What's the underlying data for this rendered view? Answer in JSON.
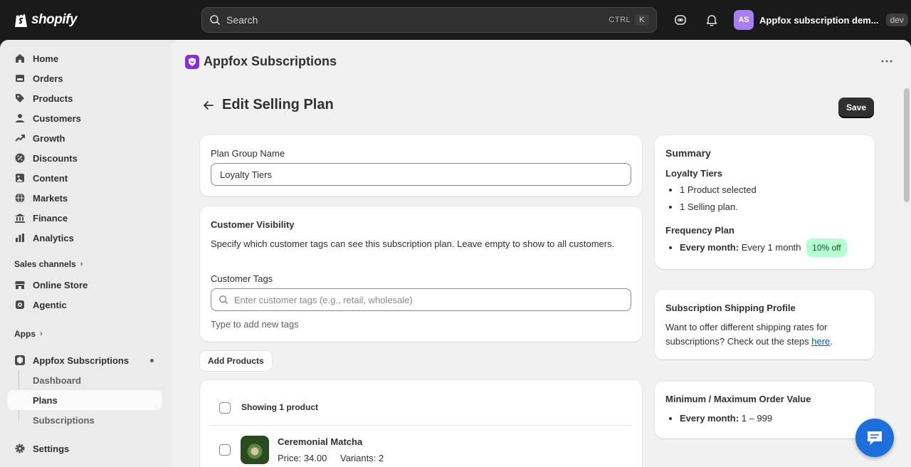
{
  "topbar": {
    "logo_text": "shopify",
    "search_placeholder": "Search",
    "shortcut_ctrl": "CTRL",
    "shortcut_key": "K",
    "store_initials": "AS",
    "store_name": "Appfox subscription dem...",
    "store_badge": "dev"
  },
  "sidebar": {
    "items": [
      {
        "label": "Home",
        "icon": "home-icon"
      },
      {
        "label": "Orders",
        "icon": "orders-icon"
      },
      {
        "label": "Products",
        "icon": "tag-icon"
      },
      {
        "label": "Customers",
        "icon": "person-icon"
      },
      {
        "label": "Growth",
        "icon": "growth-icon"
      },
      {
        "label": "Discounts",
        "icon": "discount-icon"
      },
      {
        "label": "Content",
        "icon": "content-icon"
      },
      {
        "label": "Markets",
        "icon": "globe-icon"
      },
      {
        "label": "Finance",
        "icon": "bank-icon"
      },
      {
        "label": "Analytics",
        "icon": "chart-icon"
      }
    ],
    "sales_channels_title": "Sales channels",
    "sales_channels": [
      {
        "label": "Online Store",
        "icon": "store-icon"
      },
      {
        "label": "Agentic",
        "icon": "agentic-icon"
      }
    ],
    "apps_title": "Apps",
    "app_name": "Appfox Subscriptions",
    "app_sub_items": [
      "Dashboard",
      "Plans",
      "Subscriptions"
    ],
    "settings_label": "Settings"
  },
  "main": {
    "app_title": "Appfox Subscriptions",
    "page_title": "Edit Selling Plan",
    "save_label": "Save",
    "plan_group": {
      "label": "Plan Group Name",
      "value": "Loyalty Tiers"
    },
    "visibility": {
      "title": "Customer Visibility",
      "description": "Specify which customer tags can see this subscription plan. Leave empty to show to all customers.",
      "tags_label": "Customer Tags",
      "tags_placeholder": "Enter customer tags (e.g., retail, wholesale)",
      "hint": "Type to add new tags"
    },
    "add_products_label": "Add Products",
    "products": {
      "header": "Showing 1 product",
      "rows": [
        {
          "name": "Ceremonial Matcha",
          "price": "Price: 34.00",
          "variants": "Variants: 2"
        }
      ]
    }
  },
  "summary": {
    "title": "Summary",
    "group_name": "Loyalty Tiers",
    "bullets": [
      "1 Product selected",
      "1 Selling plan."
    ],
    "frequency_title": "Frequency Plan",
    "frequency_label": "Every month:",
    "frequency_value": "Every 1 month",
    "frequency_badge": "10% off"
  },
  "shipping": {
    "title": "Subscription Shipping Profile",
    "text": "Want to offer different shipping rates for subscriptions? Check out the steps ",
    "link": "here",
    "tail": "."
  },
  "order_value": {
    "title": "Minimum / Maximum Order Value",
    "label": "Every month:",
    "value": "1 – 999"
  }
}
